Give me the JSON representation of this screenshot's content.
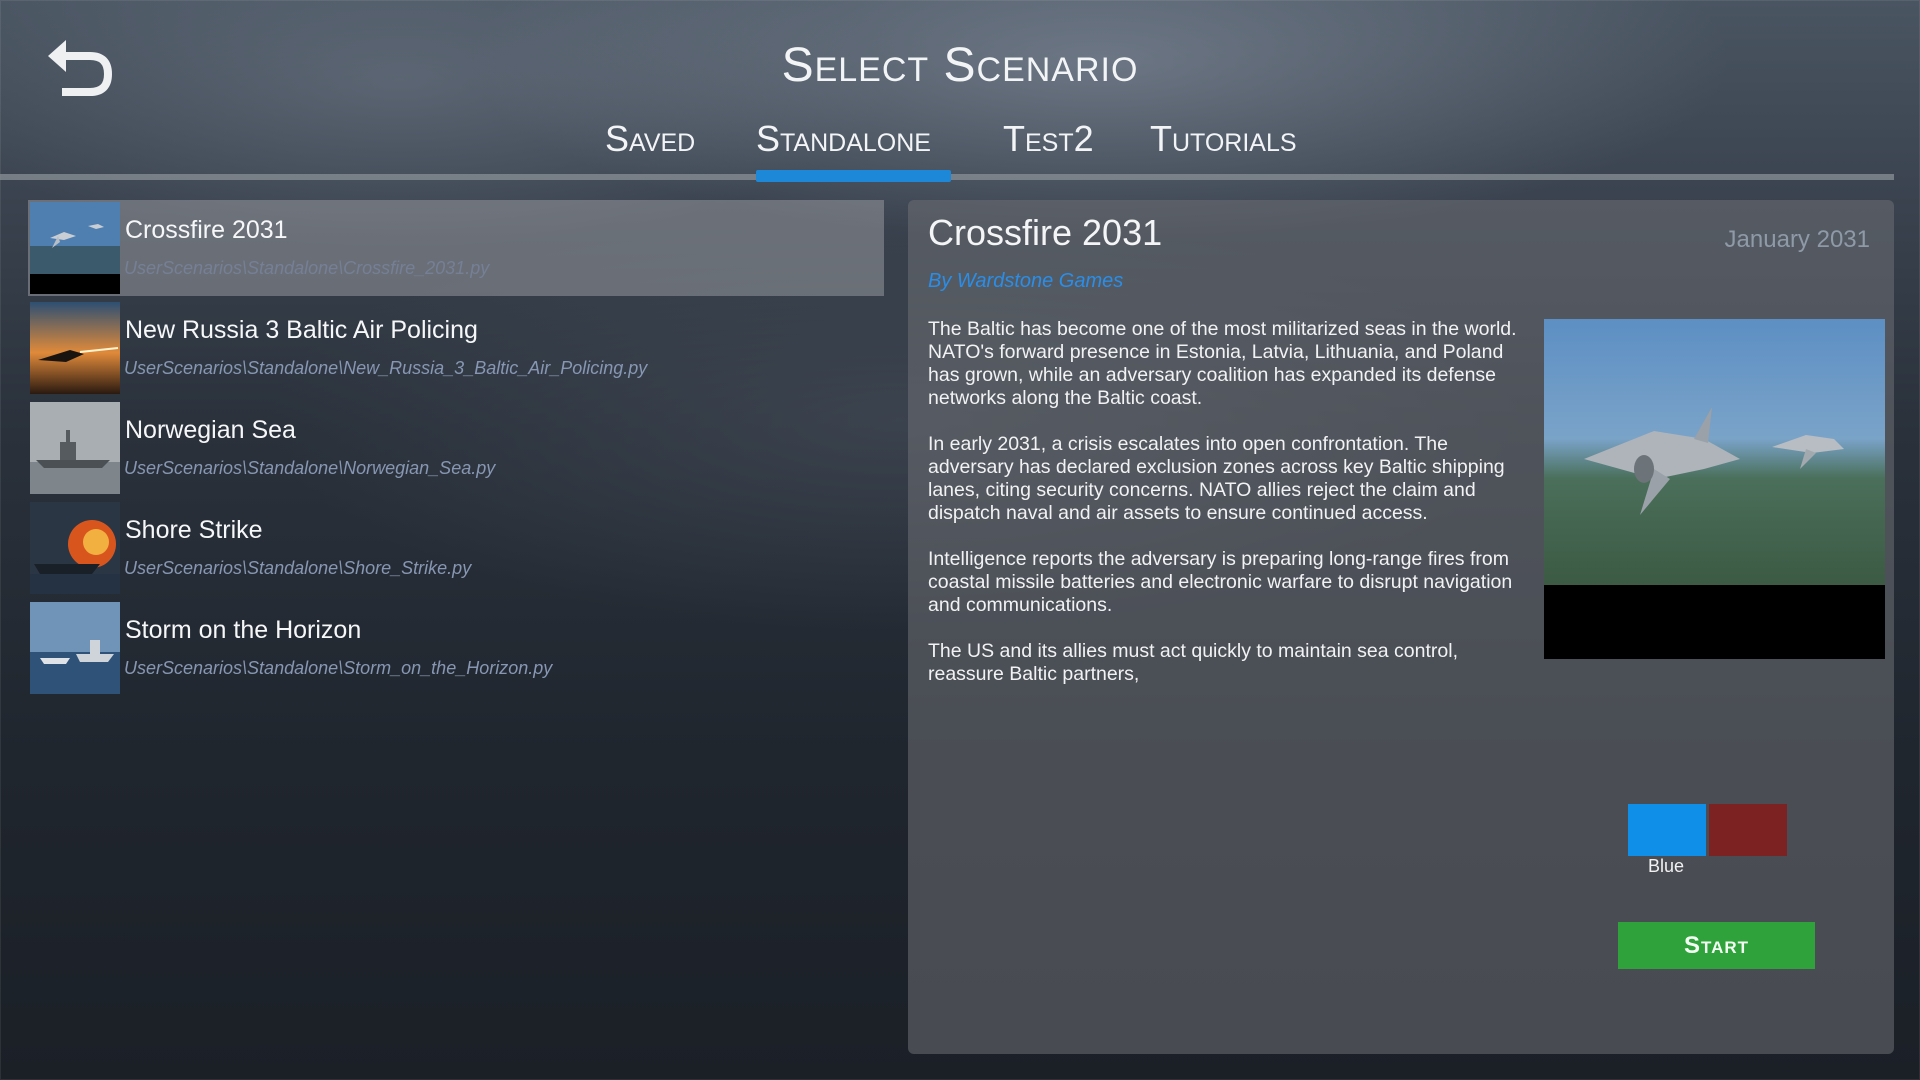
{
  "header": {
    "title": "Select Scenario",
    "back_icon": "back-arrow-icon"
  },
  "tabs": [
    {
      "label": "Saved",
      "active": false
    },
    {
      "label": "Standalone",
      "active": true
    },
    {
      "label": "Test2",
      "active": false
    },
    {
      "label": "Tutorials",
      "active": false
    }
  ],
  "scenarios": [
    {
      "name": "Crossfire 2031",
      "path": "UserScenarios\\Standalone\\Crossfire_2031.py",
      "selected": true,
      "thumb_icon": "fighter-jets-thumbnail"
    },
    {
      "name": "New Russia 3 Baltic Air Policing",
      "path": "UserScenarios\\Standalone\\New_Russia_3_Baltic_Air_Policing.py",
      "selected": false,
      "thumb_icon": "jet-sunset-thumbnail"
    },
    {
      "name": "Norwegian Sea",
      "path": "UserScenarios\\Standalone\\Norwegian_Sea.py",
      "selected": false,
      "thumb_icon": "warship-fog-thumbnail"
    },
    {
      "name": "Shore Strike",
      "path": "UserScenarios\\Standalone\\Shore_Strike.py",
      "selected": false,
      "thumb_icon": "ship-explosion-thumbnail"
    },
    {
      "name": "Storm on the Horizon",
      "path": "UserScenarios\\Standalone\\Storm_on_the_Horizon.py",
      "selected": false,
      "thumb_icon": "naval-fleet-thumbnail"
    }
  ],
  "detail": {
    "title": "Crossfire 2031",
    "date": "January 2031",
    "author": "By Wardstone Games",
    "paragraphs": [
      "The Baltic has become one of the most militarized seas in the world. NATO's forward presence in Estonia, Latvia, Lithuania, and Poland has grown, while an adversary coalition has expanded its defense networks along the Baltic coast.",
      "In early 2031, a crisis escalates into open confrontation. The adversary has declared exclusion zones across key Baltic shipping lanes, citing security concerns. NATO allies reject the claim and dispatch naval and air assets to ensure continued access.",
      "Intelligence reports the adversary is preparing long-range fires from coastal missile batteries and electronic warfare to disrupt navigation and communications.",
      "The US and its allies must act quickly to maintain sea control, reassure Baltic partners,"
    ],
    "image_icon": "f35-jets-over-land-image",
    "sides": [
      {
        "color": "#108fe8",
        "selected": true
      },
      {
        "color": "#7d2222",
        "selected": false
      }
    ],
    "side_label": "Blue",
    "start_label": "Start"
  },
  "colors": {
    "accent": "#1e88d8",
    "author": "#2a8ee8",
    "start": "#2fa23b"
  }
}
